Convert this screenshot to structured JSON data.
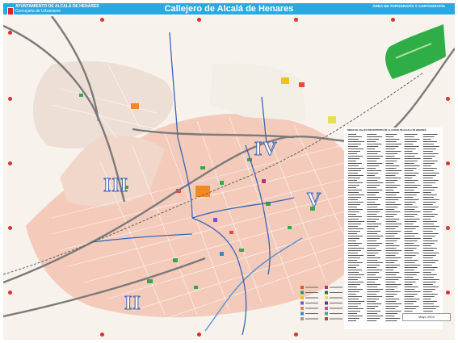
{
  "header": {
    "org_name": "AYUNTAMIENTO DE ALCALÁ DE HENARES",
    "org_dept": "Concejalía de Urbanismo",
    "map_title": "Callejero de Alcalá de Henares",
    "dept_name": "ÁREA DE TOPOGRAFÍA Y CARTOGRAFÍA",
    "dept_note": "",
    "colors": {
      "bar": "#29a9e1",
      "text": "#ffffff"
    }
  },
  "map": {
    "district_labels": [
      "II",
      "III",
      "IV",
      "V"
    ],
    "colors": {
      "urban_fill": "#f4cbbb",
      "street": "#ffffff",
      "highway": "#7a7a7a",
      "district_boundary": "#3b64b5",
      "green_area": "#35a84a",
      "golf_course": "#2fae48",
      "river": "#5a8fd6",
      "grid_marker": "#e03030"
    },
    "icons": [
      "crest-icon",
      "golf-course-icon",
      "river-icon",
      "facility-marker-icon",
      "grid-marker-icon"
    ]
  },
  "index": {
    "title": "ÍNDICE DE CALLES POR DISTRITOS DE LA CIUDAD DE ALCALÁ DE HENARES",
    "column_count": 5
  },
  "legend": {
    "entry_colors": [
      "#e64b3c",
      "#2a9d4b",
      "#f0c020",
      "#7a52c8",
      "#f08a24",
      "#3a86d0",
      "#9b9b9b",
      "#c03070",
      "#1f7a3a",
      "#e9e050",
      "#5a3a8a",
      "#d64a9a",
      "#4aa0a0",
      "#a0522d"
    ]
  },
  "footer": {
    "date": "Mayo 2003"
  }
}
